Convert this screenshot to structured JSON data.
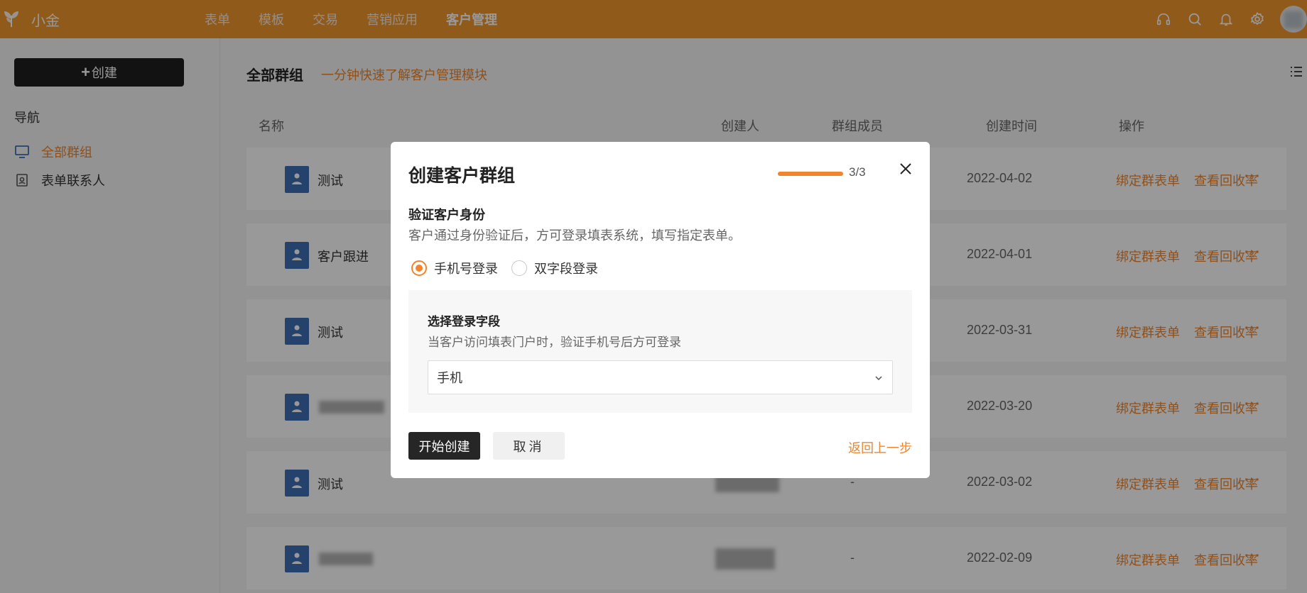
{
  "topbar": {
    "app_title": "小金",
    "nav": [
      "表单",
      "模板",
      "交易",
      "营销应用",
      "客户管理"
    ],
    "active_nav": "客户管理",
    "icons": [
      "headset-icon",
      "search-icon",
      "bell-icon",
      "gear-icon"
    ],
    "brand_color": "#f0962d"
  },
  "sidebar": {
    "create_plus": "+",
    "create_label": "创建",
    "nav_label": "导航",
    "items": [
      {
        "label": "全部群组",
        "icon": "monitor-icon",
        "active": true
      },
      {
        "label": "表单联系人",
        "icon": "contact-card-icon",
        "active": false
      }
    ]
  },
  "main": {
    "title": "全部群组",
    "intro_link": "一分钟快速了解客户管理模块",
    "columns": [
      "名称",
      "创建人",
      "群组成员",
      "创建时间",
      "操作"
    ],
    "rows": [
      {
        "name": "测试",
        "date": "2022-04-02",
        "member": "",
        "bind": "绑定群表单",
        "view": "查看回收率",
        "more": "···"
      },
      {
        "name": "客户跟进",
        "date": "2022-04-01",
        "member": "",
        "bind": "绑定群表单",
        "view": "查看回收率",
        "more": "···"
      },
      {
        "name": "测试",
        "date": "2022-03-31",
        "member": "",
        "bind": "绑定群表单",
        "view": "查看回收率",
        "more": "···"
      },
      {
        "name": "",
        "date": "2022-03-20",
        "member": "",
        "bind": "绑定群表单",
        "view": "查看回收率",
        "more": "···"
      },
      {
        "name": "测试",
        "date": "2022-03-02",
        "member": "-",
        "bind": "绑定群表单",
        "view": "查看回收率",
        "more": "···"
      },
      {
        "name": "",
        "date": "2022-02-09",
        "member": "-",
        "bind": "绑定群表单",
        "view": "查看回收率",
        "more": "···"
      }
    ],
    "accent_color": "#f0852c"
  },
  "modal": {
    "title": "创建客户群组",
    "progress": "3/3",
    "progress_fraction": 1.0,
    "section_title": "验证客户身份",
    "section_desc": "客户通过身份验证后，方可登录填表系统，填写指定表单。",
    "radio_options": [
      {
        "label": "手机号登录",
        "checked": true
      },
      {
        "label": "双字段登录",
        "checked": false
      }
    ],
    "panel_title": "选择登录字段",
    "panel_desc": "当客户访问填表门户时，验证手机号后方可登录",
    "select_value": "手机",
    "start_button": "开始创建",
    "cancel_button": "取消",
    "back_link": "返回上一步"
  }
}
